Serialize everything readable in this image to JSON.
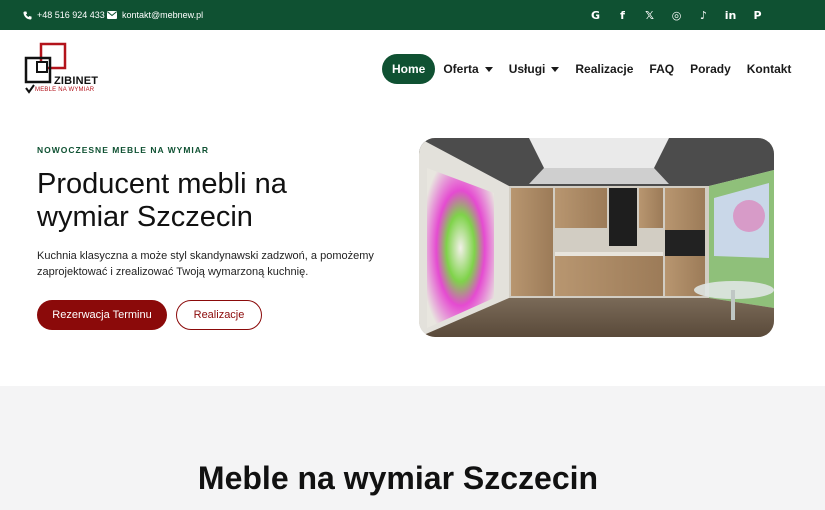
{
  "topbar": {
    "phone": "+48 516 924 433",
    "email": "kontakt@mebnew.pl",
    "socials": [
      {
        "icon": "google-icon",
        "glyph": "G"
      },
      {
        "icon": "facebook-icon",
        "glyph": "f"
      },
      {
        "icon": "x-twitter-icon",
        "glyph": "𝕏"
      },
      {
        "icon": "instagram-icon",
        "glyph": "◎"
      },
      {
        "icon": "tiktok-icon",
        "glyph": "♪"
      },
      {
        "icon": "linkedin-icon",
        "glyph": "in"
      },
      {
        "icon": "pinterest-icon",
        "glyph": "P"
      }
    ]
  },
  "logo": {
    "brand": "ZIBINET",
    "tagline": "MEBLE NA WYMIAR"
  },
  "nav": {
    "items": [
      {
        "label": "Home",
        "active": true,
        "dropdown": false
      },
      {
        "label": "Oferta",
        "active": false,
        "dropdown": true
      },
      {
        "label": "Usługi",
        "active": false,
        "dropdown": true
      },
      {
        "label": "Realizacje",
        "active": false,
        "dropdown": false
      },
      {
        "label": "FAQ",
        "active": false,
        "dropdown": false
      },
      {
        "label": "Porady",
        "active": false,
        "dropdown": false
      },
      {
        "label": "Kontakt",
        "active": false,
        "dropdown": false
      }
    ]
  },
  "hero": {
    "eyebrow": "NOWOCZESNE MEBLE NA WYMIAR",
    "title_line1": "Producent mebli na",
    "title_line2": "wymiar Szczecin",
    "lead": "Kuchnia klasyczna a może styl skandynawski zadzwoń, a pomożemy zaprojektować i zrealizować Twoją wymarzoną kuchnię.",
    "primary_cta": "Rezerwacja Terminu",
    "secondary_cta": "Realizacje"
  },
  "section2": {
    "title": "Meble na wymiar Szczecin"
  },
  "colors": {
    "brand_green": "#0f5132",
    "brand_red": "#8b0a0a"
  }
}
